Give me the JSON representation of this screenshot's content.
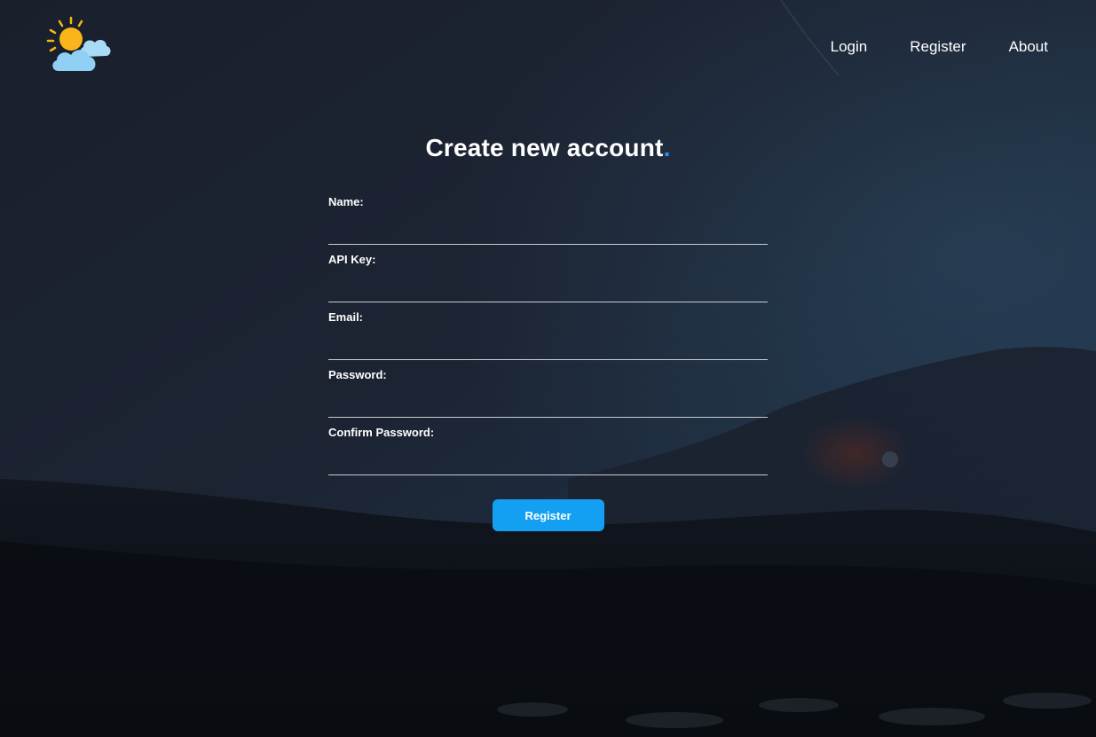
{
  "nav": {
    "items": [
      {
        "label": "Login"
      },
      {
        "label": "Register"
      },
      {
        "label": "About"
      }
    ]
  },
  "logo": {
    "icon": "sun-cloud-icon"
  },
  "form": {
    "title": "Create new account",
    "title_dot": ".",
    "fields": [
      {
        "label": "Name:",
        "value": ""
      },
      {
        "label": "API Key:",
        "value": ""
      },
      {
        "label": "Email:",
        "value": ""
      },
      {
        "label": "Password:",
        "value": ""
      },
      {
        "label": "Confirm Password:",
        "value": ""
      }
    ],
    "submit_label": "Register"
  },
  "colors": {
    "accent": "#14a0f2",
    "title_dot": "#2196f3",
    "sun": "#f9b51a",
    "cloud": "#8fd0f4"
  }
}
